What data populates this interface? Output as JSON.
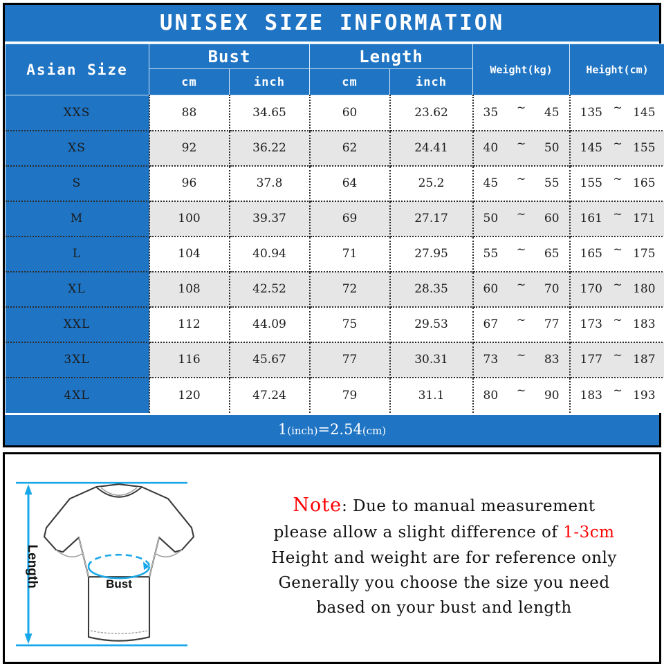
{
  "header": {
    "title": "UNISEX SIZE INFORMATION"
  },
  "table": {
    "columns": {
      "size": "Asian Size",
      "bust": "Bust",
      "length": "Length",
      "bust_cm": "cm",
      "bust_inch": "inch",
      "length_cm": "cm",
      "length_inch": "inch",
      "weight": "Weight(kg)",
      "height": "Height(cm)"
    },
    "tilde": "~",
    "rows": [
      {
        "size": "XXS",
        "bust_cm": "88",
        "bust_inch": "34.65",
        "length_cm": "60",
        "length_inch": "23.62",
        "weight_min": "35",
        "weight_max": "45",
        "height_min": "135",
        "height_max": "145"
      },
      {
        "size": "XS",
        "bust_cm": "92",
        "bust_inch": "36.22",
        "length_cm": "62",
        "length_inch": "24.41",
        "weight_min": "40",
        "weight_max": "50",
        "height_min": "145",
        "height_max": "155"
      },
      {
        "size": "S",
        "bust_cm": "96",
        "bust_inch": "37.8",
        "length_cm": "64",
        "length_inch": "25.2",
        "weight_min": "45",
        "weight_max": "55",
        "height_min": "155",
        "height_max": "165"
      },
      {
        "size": "M",
        "bust_cm": "100",
        "bust_inch": "39.37",
        "length_cm": "69",
        "length_inch": "27.17",
        "weight_min": "50",
        "weight_max": "60",
        "height_min": "161",
        "height_max": "171"
      },
      {
        "size": "L",
        "bust_cm": "104",
        "bust_inch": "40.94",
        "length_cm": "71",
        "length_inch": "27.95",
        "weight_min": "55",
        "weight_max": "65",
        "height_min": "165",
        "height_max": "175"
      },
      {
        "size": "XL",
        "bust_cm": "108",
        "bust_inch": "42.52",
        "length_cm": "72",
        "length_inch": "28.35",
        "weight_min": "60",
        "weight_max": "70",
        "height_min": "170",
        "height_max": "180"
      },
      {
        "size": "XXL",
        "bust_cm": "112",
        "bust_inch": "44.09",
        "length_cm": "75",
        "length_inch": "29.53",
        "weight_min": "67",
        "weight_max": "77",
        "height_min": "173",
        "height_max": "183"
      },
      {
        "size": "3XL",
        "bust_cm": "116",
        "bust_inch": "45.67",
        "length_cm": "77",
        "length_inch": "30.31",
        "weight_min": "73",
        "weight_max": "83",
        "height_min": "177",
        "height_max": "187"
      },
      {
        "size": "4XL",
        "bust_cm": "120",
        "bust_inch": "47.24",
        "length_cm": "79",
        "length_inch": "31.1",
        "weight_min": "80",
        "weight_max": "90",
        "height_min": "183",
        "height_max": "193"
      }
    ]
  },
  "conversion": {
    "value_one": "1",
    "unit_inch": "(inch)",
    "equals": "=2.54",
    "unit_cm": "(cm)"
  },
  "diagram": {
    "length_label": "Length",
    "bust_label": "Bust"
  },
  "note": {
    "keyword": "Note",
    "line1_rest": ": Due to manual measurement",
    "line2_a": "please allow a slight difference of ",
    "line2_highlight": "1-3cm",
    "line3": "Height and weight are for reference only",
    "line4": "Generally you choose the size you need",
    "line5": "based on your bust and length"
  },
  "colors": {
    "brand_blue": "#1f74c4",
    "accent_cyan": "#18a7e8",
    "alt_row": "#e6e6e6",
    "red": "#ff0000"
  }
}
